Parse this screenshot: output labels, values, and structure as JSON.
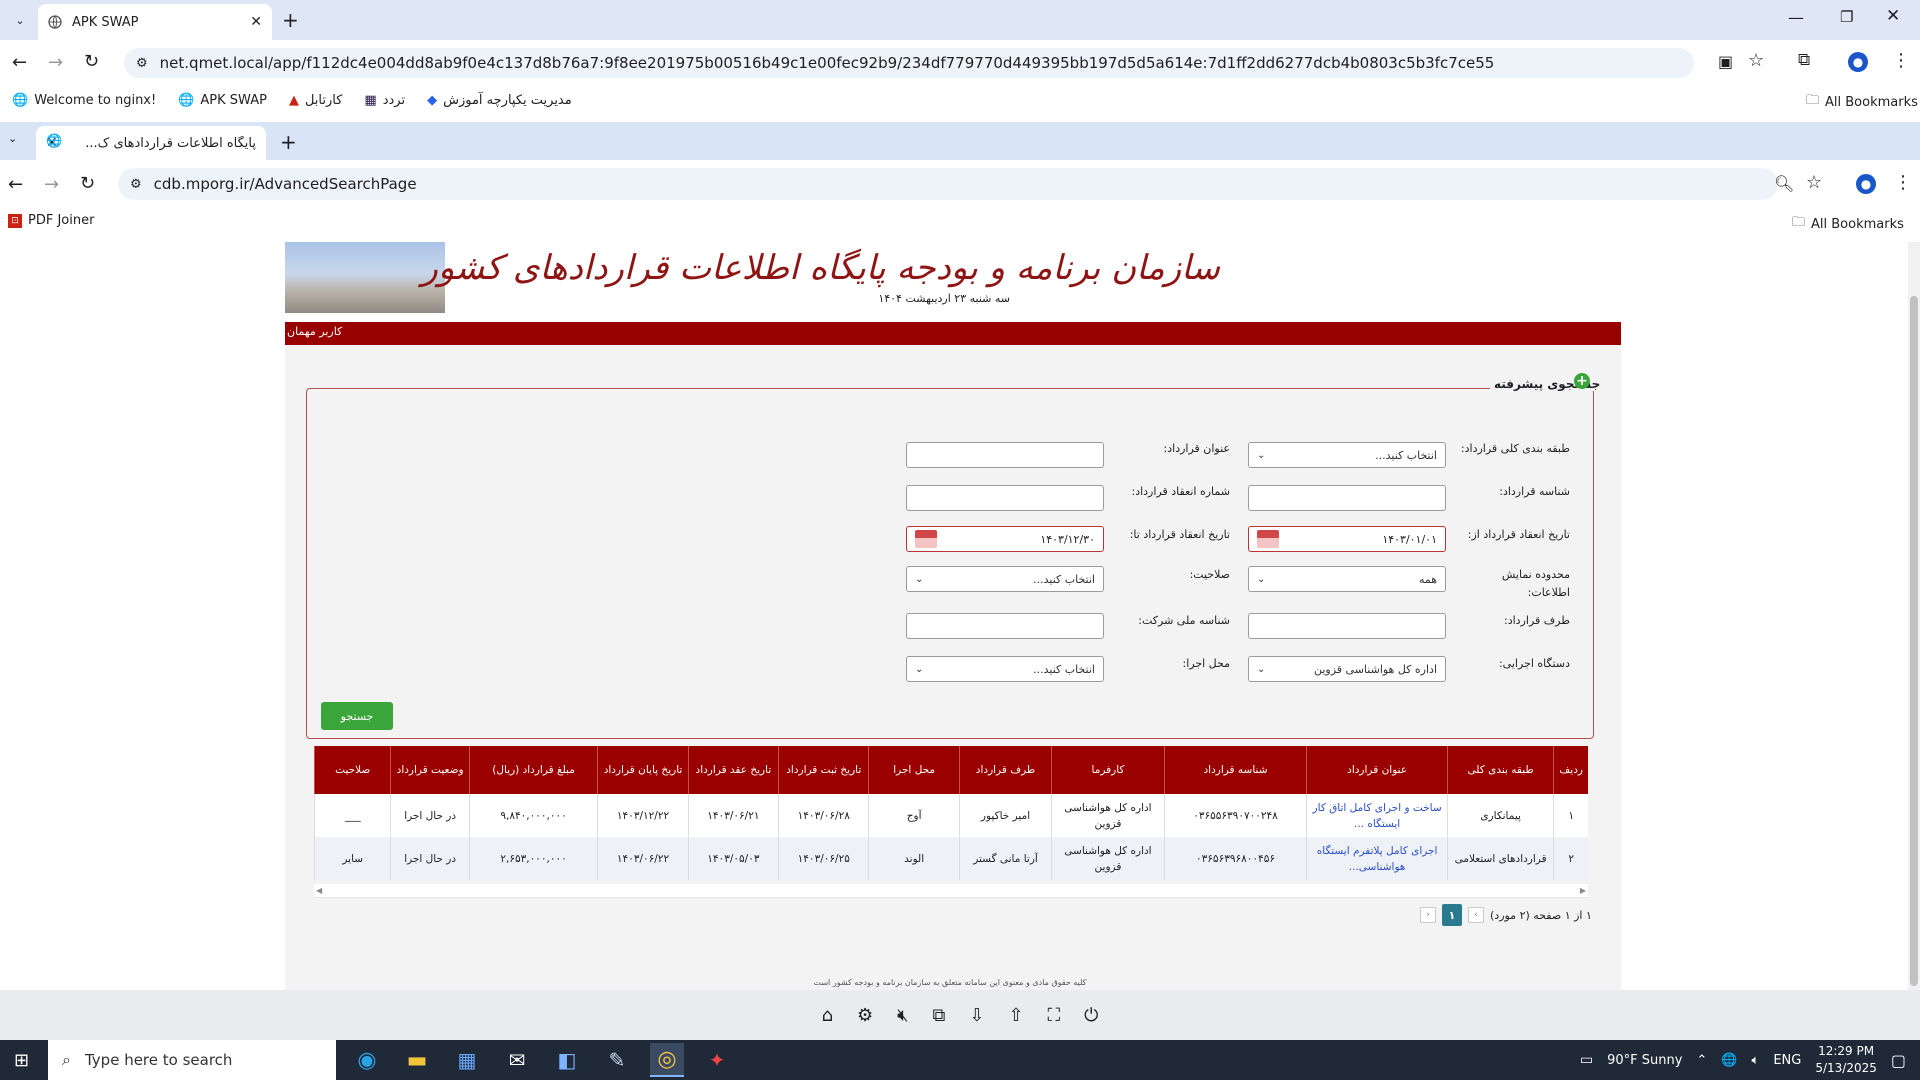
{
  "outer_browser": {
    "tab_title": "APK SWAP",
    "url": "net.qmet.local/app/f112dc4e004dd8ab9f0e4c137d8b76a7:9f8ee201975b00516b49c1e00fec92b9/234df779770d449395bb197d5d5a614e:7d1ff2dd6277dcb4b0803c5b3fc7ce55",
    "bookmarks": [
      "Welcome to nginx!",
      "APK SWAP",
      "کارتابل",
      "تردد",
      "مدیریت یکپارچه آموزش"
    ],
    "all_bookmarks": "All Bookmarks"
  },
  "inner_browser": {
    "tab_title": "پایگاه اطلاعات قراردادهای ک...",
    "url": "cdb.mporg.ir/AdvancedSearchPage",
    "bookmarks": [
      "PDF Joiner"
    ],
    "all_bookmarks": "All Bookmarks"
  },
  "header": {
    "title": "سازمان برنامه و بودجه پایگاه اطلاعات قراردادهای کشور",
    "date": "سه شنبه ۲۳ اردیبهشت ۱۴۰۴",
    "user": "کاربر مهمان"
  },
  "search": {
    "section_title": "جستجوی پیشرفته",
    "fields": {
      "category_label": "طبقه بندی کلی قرارداد:",
      "category_value": "انتخاب کنید...",
      "title_label": "عنوان قرارداد:",
      "title_value": "",
      "contract_id_label": "شناسه قرارداد:",
      "contract_id_value": "",
      "contract_no_label": "شماره انعقاد قرارداد:",
      "contract_no_value": "",
      "date_from_label": "تاریخ انعقاد قرارداد از:",
      "date_from_value": "۱۴۰۳/۰۱/۰۱",
      "date_to_label": "تاریخ انعقاد قرارداد تا:",
      "date_to_value": "۱۴۰۳/۱۲/۳۰",
      "scope_label": "محدوده نمایش اطلاعات:",
      "scope_value": "همه",
      "qualification_label": "صلاحیت:",
      "qualification_value": "انتخاب کنید...",
      "party_label": "طرف قرارداد:",
      "party_value": "",
      "company_id_label": "شناسه ملی شرکت:",
      "company_id_value": "",
      "agency_label": "دستگاه اجرایی:",
      "agency_value": "اداره کل هواشناسی قزوین",
      "location_label": "محل اجرا:",
      "location_value": "انتخاب کنید..."
    },
    "submit_label": "جستجو"
  },
  "table": {
    "columns": [
      "ردیف",
      "طبقه بندی کلی",
      "عنوان قرارداد",
      "شناسه قرارداد",
      "کارفرما",
      "طرف قرارداد",
      "محل اجرا",
      "تاریخ ثبت قرارداد",
      "تاریخ عقد قرارداد",
      "تاریخ پایان قرارداد",
      "مبلغ قرارداد (ریال)",
      "وضعیت قرارداد",
      "صلاحیت"
    ],
    "rows": [
      [
        "۱",
        "پیمانکاری",
        "ساخت و اجرای کامل اتاق کار ایستگاه ...",
        "۰۳۶۵۵۶۳۹۰۷۰۰۲۴۸",
        "اداره کل هواشناسی قزوین",
        "امیر خاکپور",
        "آوج",
        "۱۴۰۳/۰۶/۲۸",
        "۱۴۰۳/۰۶/۲۱",
        "۱۴۰۳/۱۲/۲۲",
        "۹,۸۴۰,۰۰۰,۰۰۰",
        "در حال اجرا",
        "___"
      ],
      [
        "۲",
        "قراردادهای استعلامی",
        "اجرای کامل پلاتفرم ایستگاه هواشناسی...",
        "۰۳۶۵۶۳۹۶۸۰۰۴۵۶",
        "اداره کل هواشناسی قزوین",
        "آرتا مانی گستر",
        "الوند",
        "۱۴۰۳/۰۶/۲۵",
        "۱۴۰۳/۰۵/۰۳",
        "۱۴۰۳/۰۶/۲۲",
        "۲,۶۵۳,۰۰۰,۰۰۰",
        "در حال اجرا",
        "سایر"
      ]
    ]
  },
  "pager": {
    "summary": "۱ از ۱ صفحه (۲ مورد)",
    "current": "۱"
  },
  "footer": "کلیه حقوق مادی و معنوی این سامانه متعلق به سازمان برنامه و بودجه کشور است",
  "taskbar": {
    "search_placeholder": "Type here to search",
    "weather": "90°F  Sunny",
    "lang": "ENG",
    "time": "12:29 PM",
    "date": "5/13/2025"
  }
}
